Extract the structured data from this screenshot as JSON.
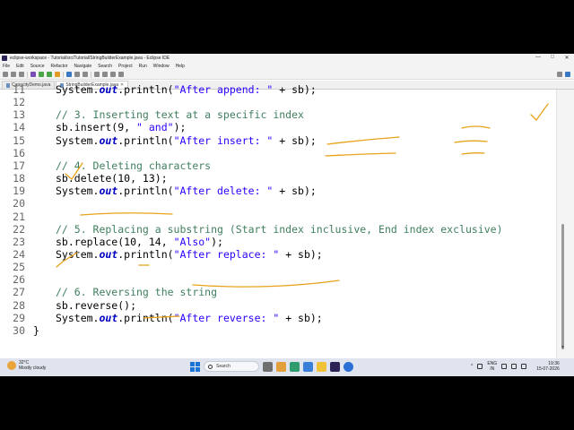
{
  "window": {
    "title": "eclipse-workspace - Tutorial/src/Tutorial/StringBuilderExample.java - Eclipse IDE",
    "controls": [
      "—",
      "□",
      "✕"
    ]
  },
  "menu": [
    "File",
    "Edit",
    "Source",
    "Refactor",
    "Navigate",
    "Search",
    "Project",
    "Run",
    "Window",
    "Help"
  ],
  "tabs": [
    {
      "label": "CapacityDemo.java",
      "active": false
    },
    {
      "label": "StringBuilderExample.java",
      "active": true
    }
  ],
  "editor": {
    "lines": [
      {
        "n": "11",
        "parts": [
          {
            "t": "System.",
            "c": "kw"
          },
          {
            "t": "out",
            "c": "fld"
          },
          {
            "t": ".println(",
            "c": "kw"
          },
          {
            "t": "\"After append: \"",
            "c": "st"
          },
          {
            "t": " + sb);",
            "c": "kw"
          }
        ]
      },
      {
        "n": "12",
        "parts": []
      },
      {
        "n": "13",
        "parts": [
          {
            "t": "// 3. Inserting text at a specific index",
            "c": "cm"
          }
        ]
      },
      {
        "n": "14",
        "parts": [
          {
            "t": "sb.insert(9, ",
            "c": "kw"
          },
          {
            "t": "\" and\"",
            "c": "st"
          },
          {
            "t": ");",
            "c": "kw"
          }
        ]
      },
      {
        "n": "15",
        "parts": [
          {
            "t": "System.",
            "c": "kw"
          },
          {
            "t": "out",
            "c": "fld"
          },
          {
            "t": ".println(",
            "c": "kw"
          },
          {
            "t": "\"After insert: \"",
            "c": "st"
          },
          {
            "t": " + sb);",
            "c": "kw"
          }
        ]
      },
      {
        "n": "16",
        "parts": []
      },
      {
        "n": "17",
        "parts": [
          {
            "t": "// 4. Deleting characters",
            "c": "cm"
          }
        ]
      },
      {
        "n": "18",
        "parts": [
          {
            "t": "sb.delete(10, 13);",
            "c": "kw"
          }
        ]
      },
      {
        "n": "19",
        "parts": [
          {
            "t": "System.",
            "c": "kw"
          },
          {
            "t": "out",
            "c": "fld"
          },
          {
            "t": ".println(",
            "c": "kw"
          },
          {
            "t": "\"After delete: \"",
            "c": "st"
          },
          {
            "t": " + sb);",
            "c": "kw"
          }
        ]
      },
      {
        "n": "20",
        "parts": []
      },
      {
        "n": "21",
        "parts": []
      },
      {
        "n": "22",
        "parts": [
          {
            "t": "// 5. Replacing a substring (Start index inclusive, End index exclusive)",
            "c": "cm"
          }
        ]
      },
      {
        "n": "23",
        "parts": [
          {
            "t": "sb.replace(10, 14, ",
            "c": "kw"
          },
          {
            "t": "\"Also\"",
            "c": "st"
          },
          {
            "t": ");",
            "c": "kw"
          }
        ]
      },
      {
        "n": "24",
        "parts": [
          {
            "t": "System.",
            "c": "kw"
          },
          {
            "t": "out",
            "c": "fld"
          },
          {
            "t": ".println(",
            "c": "kw"
          },
          {
            "t": "\"After replace: \"",
            "c": "st"
          },
          {
            "t": " + sb);",
            "c": "kw"
          }
        ]
      },
      {
        "n": "25",
        "parts": []
      },
      {
        "n": "26",
        "parts": []
      },
      {
        "n": "27",
        "parts": [
          {
            "t": "// 6. Reversing the string",
            "c": "cm"
          }
        ]
      },
      {
        "n": "28",
        "parts": [
          {
            "t": "sb.reverse();",
            "c": "kw"
          }
        ]
      },
      {
        "n": "29",
        "parts": [
          {
            "t": "System.",
            "c": "kw"
          },
          {
            "t": "out",
            "c": "fld"
          },
          {
            "t": ".println(",
            "c": "kw"
          },
          {
            "t": "\"After reverse: \"",
            "c": "st"
          },
          {
            "t": " + sb);",
            "c": "kw"
          }
        ]
      },
      {
        "n": "30",
        "parts": [
          {
            "t": "}",
            "c": "kw"
          }
        ]
      }
    ]
  },
  "taskbar": {
    "weather_temp": "32°C",
    "weather_desc": "Mostly cloudy",
    "search_label": "Search",
    "lang_top": "ENG",
    "lang_bottom": "IN",
    "time": "19:36",
    "date": "15-07-2026"
  },
  "colors": {
    "comment": "#3f7f5f",
    "string": "#2a00ff",
    "field": "#0000c0",
    "ink": "#e8a21a"
  }
}
